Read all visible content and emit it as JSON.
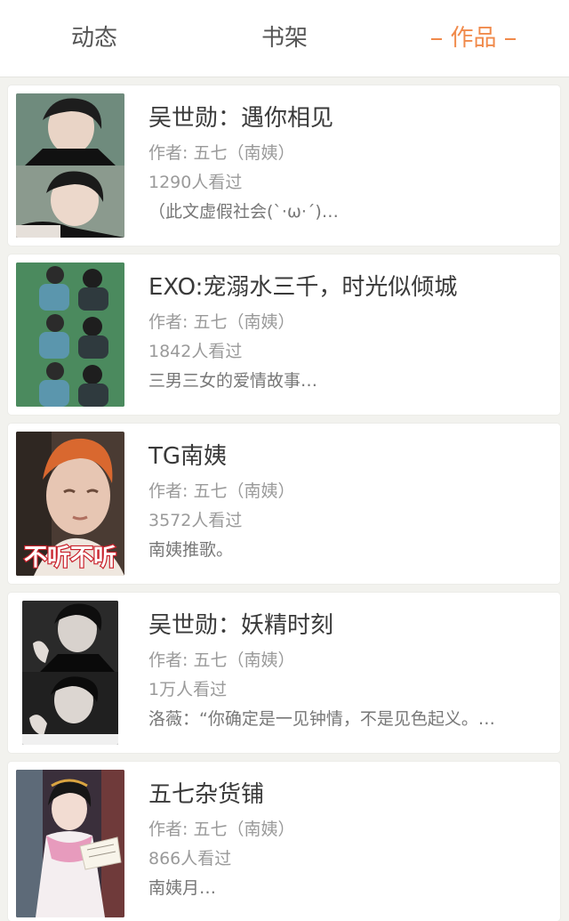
{
  "tabs": [
    {
      "label": "动态"
    },
    {
      "label": "书架"
    },
    {
      "label": "作品"
    }
  ],
  "colors": {
    "accent": "#f08a4b",
    "background": "#f2f2ee",
    "card": "#ffffff"
  },
  "works": [
    {
      "title": "吴世勋：遇你相见",
      "author": "作者: 五七（南姨）",
      "views": "1290人看过",
      "desc": "（此文虚假社会(ˋ·ω·ˊ)…",
      "cover": "portrait-collage-icon"
    },
    {
      "title": "EXO:宠溺水三千，时光似倾城",
      "author": "作者: 五七（南姨）",
      "views": "1842人看过",
      "desc": "三男三女的爱情故事…",
      "cover": "couple-collage-icon"
    },
    {
      "title": "TG南姨",
      "author": "作者: 五七（南姨）",
      "views": "3572人看过",
      "desc": "南姨推歌。",
      "cover": "meme-portrait-icon",
      "cover_text": "不听不听"
    },
    {
      "title": "吴世勋：妖精时刻",
      "author": "作者: 五七（南姨）",
      "views": "1万人看过",
      "desc": "洛薇：“你确定是一见钟情，不是见色起义。…",
      "cover": "monochrome-portrait-icon"
    },
    {
      "title": "五七杂货铺",
      "author": "作者: 五七（南姨）",
      "views": "866人看过",
      "desc": "南姨月…",
      "cover": "hanfu-girl-icon"
    }
  ]
}
